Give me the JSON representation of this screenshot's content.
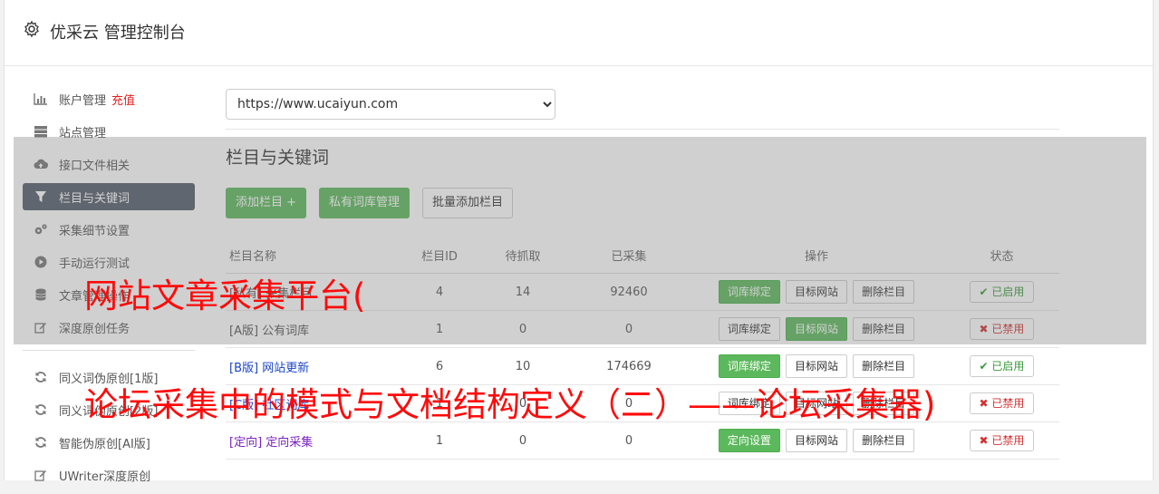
{
  "app": {
    "title": "优采云 管理控制台"
  },
  "sidebar": {
    "items": [
      {
        "label": "账户管理",
        "badge": "充值",
        "icon": "bar-chart-icon"
      },
      {
        "label": "站点管理",
        "icon": "server-icon"
      },
      {
        "label": "接口文件相关",
        "icon": "cloud-upload-icon"
      },
      {
        "label": "栏目与关键词",
        "icon": "filter-icon",
        "active": true
      },
      {
        "label": "采集细节设置",
        "icon": "cogs-icon"
      },
      {
        "label": "手动运行测试",
        "icon": "play-circle-icon"
      },
      {
        "label": "文章管理操作",
        "icon": "database-icon"
      },
      {
        "label": "深度原创任务",
        "icon": "edit-icon"
      }
    ],
    "items2": [
      {
        "label": "同义词伪原创[1版]",
        "icon": "refresh-icon"
      },
      {
        "label": "同义词伪原创[2版]",
        "icon": "refresh-icon"
      },
      {
        "label": "智能伪原创[AI版]",
        "icon": "refresh-icon"
      },
      {
        "label": "UWriter深度原创",
        "icon": "edit-icon"
      }
    ]
  },
  "main": {
    "site_select": {
      "value": "https://www.ucaiyun.com"
    },
    "section_title": "栏目与关键词",
    "buttons": {
      "add": "添加栏目 +",
      "private_lib": "私有词库管理",
      "batch_add": "批量添加栏目"
    },
    "table": {
      "headers": {
        "name": "栏目名称",
        "id": "栏目ID",
        "pending": "待抓取",
        "collected": "已采集",
        "ops": "操作",
        "status": "状态"
      },
      "rows": [
        {
          "name": "[私有] 采集栏目",
          "id": "4",
          "pending": "14",
          "collected": "92460",
          "ops": [
            "词库绑定",
            "目标网站",
            "删除栏目"
          ],
          "status": "已启用"
        },
        {
          "name": "[A版] 公有词库",
          "id": "1",
          "pending": "0",
          "collected": "0",
          "ops": [
            "词库绑定",
            "目标网站",
            "删除栏目"
          ],
          "status": "已禁用"
        },
        {
          "tag": "[B版]",
          "name": "网站更新",
          "id": "6",
          "pending": "10",
          "collected": "174669",
          "ops": [
            "词库绑定",
            "目标网站",
            "删除栏目"
          ],
          "status": "已启用"
        },
        {
          "tag": "[C版]",
          "name": "社区词库",
          "id": "1",
          "pending": "0",
          "collected": "0",
          "ops": [
            "词库绑定",
            "目标网站",
            "删除栏目"
          ],
          "status": "已禁用"
        },
        {
          "tag": "[定向]",
          "name": "定向采集",
          "id": "1",
          "pending": "0",
          "collected": "0",
          "ops": [
            "定向设置",
            "目标网站",
            "删除栏目"
          ],
          "status": "已禁用"
        }
      ]
    }
  },
  "watermarks": {
    "line1": "网站文章采集平台(",
    "line2": "论坛采集中的模式与文档结构定义（二）——论坛采集器)"
  }
}
